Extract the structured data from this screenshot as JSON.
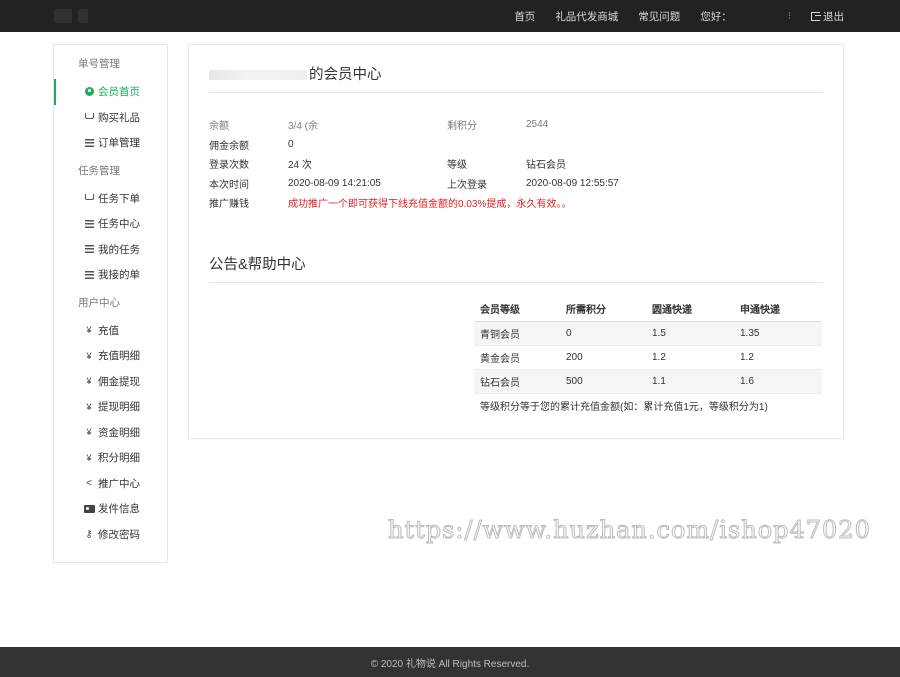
{
  "nav": {
    "items": [
      "首页",
      "礼品代发商城",
      "常见问题"
    ],
    "greeting": "您好：",
    "separator": "⁝",
    "logout": "退出"
  },
  "sidebar": {
    "groups": [
      {
        "title": "单号管理",
        "items": [
          {
            "label": "会员首页",
            "icon": "user-icon",
            "active": true
          },
          {
            "label": "购买礼品",
            "icon": "cart-icon"
          },
          {
            "label": "订单管理",
            "icon": "list-icon"
          }
        ]
      },
      {
        "title": "任务管理",
        "items": [
          {
            "label": "任务下单",
            "icon": "cart-icon"
          },
          {
            "label": "任务中心",
            "icon": "list-icon"
          },
          {
            "label": "我的任务",
            "icon": "list-icon"
          },
          {
            "label": "我接的单",
            "icon": "list-icon"
          }
        ]
      },
      {
        "title": "用户中心",
        "items": [
          {
            "label": "充值",
            "icon": "yen-icon"
          },
          {
            "label": "充值明细",
            "icon": "yen-icon"
          },
          {
            "label": "佣金提现",
            "icon": "yen-icon"
          },
          {
            "label": "提现明细",
            "icon": "yen-icon"
          },
          {
            "label": "资金明细",
            "icon": "yen-icon"
          },
          {
            "label": "积分明细",
            "icon": "yen-icon"
          },
          {
            "label": "推广中心",
            "icon": "share-icon"
          },
          {
            "label": "发件信息",
            "icon": "card-icon"
          },
          {
            "label": "修改密码",
            "icon": "key-icon"
          }
        ]
      }
    ]
  },
  "member": {
    "title": "的会员中心",
    "rows": [
      {
        "k1": "余额",
        "v1": "3/4 (余",
        "k2": "剩积分",
        "v2": "2544"
      },
      {
        "k1": "佣金余额",
        "v1": "0",
        "k2": "",
        "v2": ""
      },
      {
        "k1": "登录次数",
        "v1": "24 次",
        "k2": "等级",
        "v2": "钻石会员"
      },
      {
        "k1": "本次时间",
        "v1": "2020-08-09 14:21:05",
        "k2": "上次登录",
        "v2": "2020-08-09 12:55:57"
      }
    ],
    "promo_label": "推广赚钱",
    "promo_text": "成功推广一个即可获得下线充值金额的0.03%提成，永久有效。。"
  },
  "help": {
    "title": "公告&帮助中心",
    "headers": [
      "会员等级",
      "所需积分",
      "圆通快递",
      "申通快递"
    ],
    "rows": [
      [
        "青铜会员",
        "0",
        "1.5",
        "1.35"
      ],
      [
        "黄金会员",
        "200",
        "1.2",
        "1.2"
      ],
      [
        "钻石会员",
        "500",
        "1.1",
        "1.6"
      ]
    ],
    "note": "等级积分等于您的累计充值金额(如：累计充值1元，等级积分为1)"
  },
  "watermark": "https://www.huzhan.com/ishop47020",
  "footer": "© 2020 礼物说 All Rights Reserved."
}
